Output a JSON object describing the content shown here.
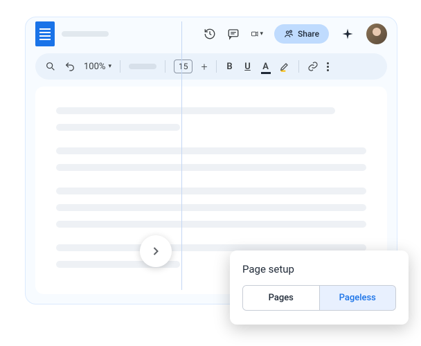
{
  "header": {
    "share_label": "Share"
  },
  "toolbar": {
    "zoom": "100%",
    "font_size": "15"
  },
  "popover": {
    "title": "Page setup",
    "pages_label": "Pages",
    "pageless_label": "Pageless"
  }
}
